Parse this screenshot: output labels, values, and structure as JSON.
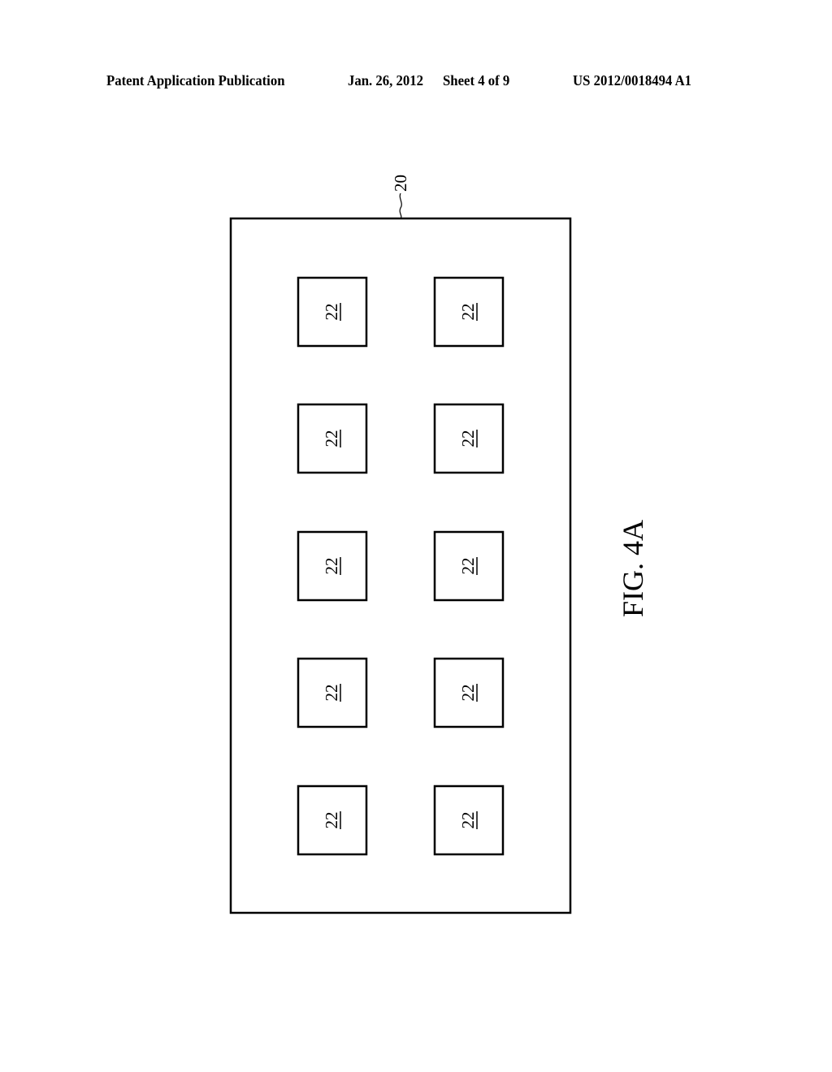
{
  "header": {
    "publication": "Patent Application Publication",
    "date": "Jan. 26, 2012",
    "sheet": "Sheet 4 of 9",
    "patent_number": "US 2012/0018494 A1"
  },
  "figure": {
    "caption": "FIG. 4A",
    "substrate": {
      "reference": "20"
    },
    "grid": {
      "rows": 5,
      "columns": 2
    },
    "elements": [
      {
        "reference": "22",
        "row": 1,
        "col": 1
      },
      {
        "reference": "22",
        "row": 1,
        "col": 2
      },
      {
        "reference": "22",
        "row": 2,
        "col": 1
      },
      {
        "reference": "22",
        "row": 2,
        "col": 2
      },
      {
        "reference": "22",
        "row": 3,
        "col": 1
      },
      {
        "reference": "22",
        "row": 3,
        "col": 2
      },
      {
        "reference": "22",
        "row": 4,
        "col": 1
      },
      {
        "reference": "22",
        "row": 4,
        "col": 2
      },
      {
        "reference": "22",
        "row": 5,
        "col": 1
      },
      {
        "reference": "22",
        "row": 5,
        "col": 2
      }
    ]
  }
}
